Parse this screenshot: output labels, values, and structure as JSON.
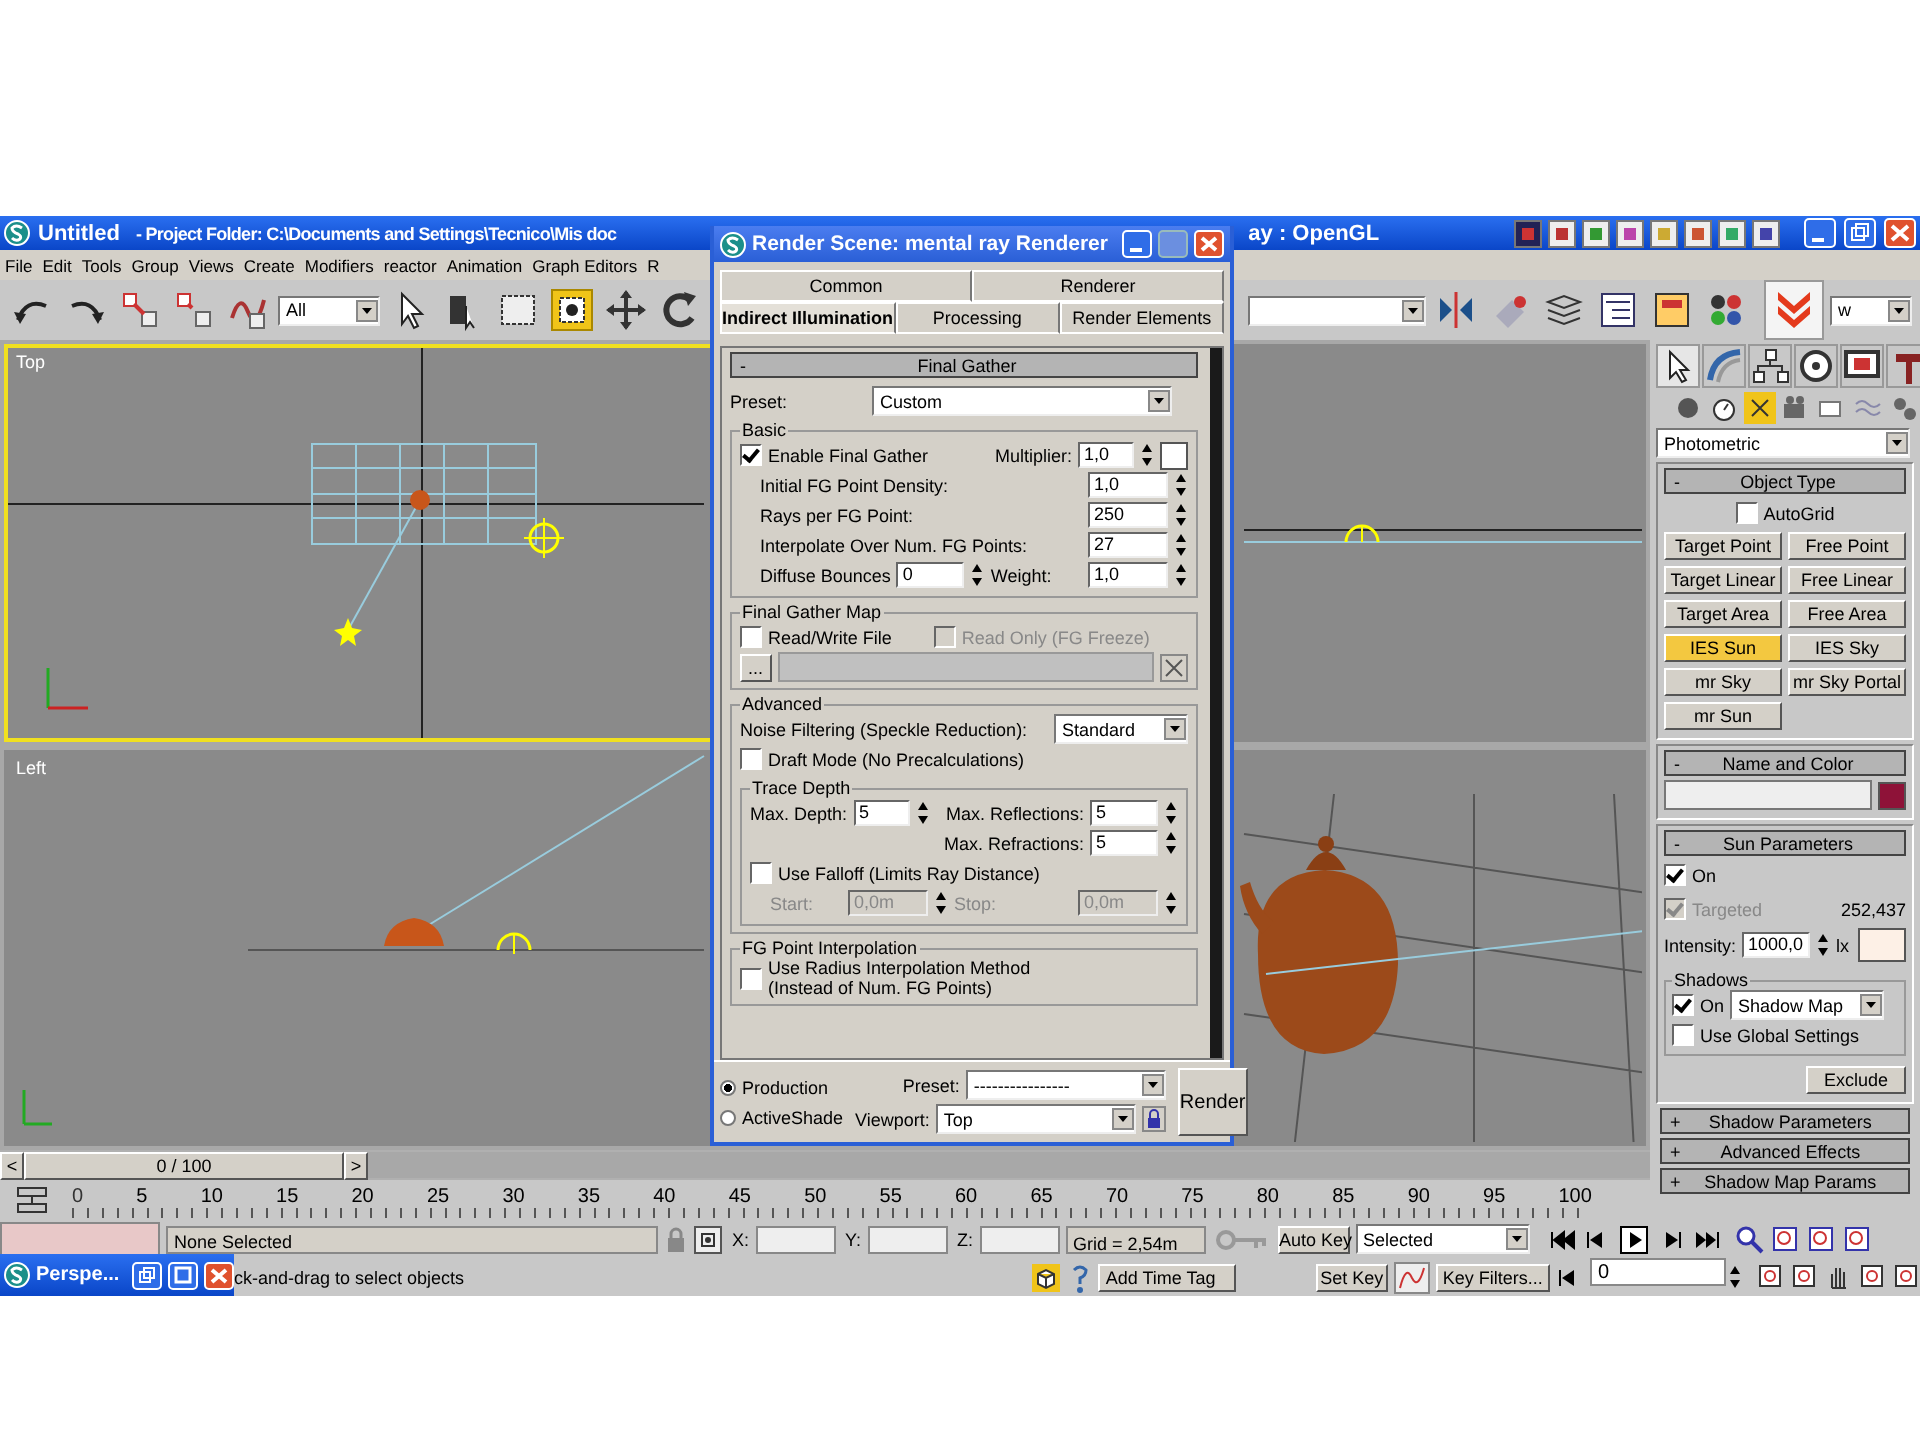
{
  "app": {
    "title": "Untitled",
    "title_path": "- Project Folder: C:\\Documents and Settings\\Tecnico\\Mis doc",
    "title_tail": "ay : OpenGL"
  },
  "menu": [
    "File",
    "Edit",
    "Tools",
    "Group",
    "Views",
    "Create",
    "Modifiers",
    "reactor",
    "Animation",
    "Graph Editors",
    "R"
  ],
  "toolbar": {
    "selection_filter": "All",
    "render_mode": "w"
  },
  "viewports": [
    {
      "kind": "top",
      "label": "Top",
      "selected": true
    },
    {
      "kind": "front",
      "selected": false
    },
    {
      "kind": "left",
      "label": "Left",
      "selected": false
    },
    {
      "kind": "perspective",
      "selected": false
    }
  ],
  "render_dialog": {
    "title": "Render Scene: mental ray Renderer",
    "tab_rows": [
      {
        "tabs": [
          {
            "label": "Common",
            "selected": false
          },
          {
            "label": "Renderer",
            "selected": false
          }
        ]
      },
      {
        "tabs": [
          {
            "label": "Indirect Illumination",
            "selected": true
          },
          {
            "label": "Processing",
            "selected": false
          },
          {
            "label": "Render Elements",
            "selected": false
          }
        ]
      }
    ],
    "rollout": {
      "sign": "-",
      "title": "Final Gather"
    },
    "preset": {
      "label": "Preset:",
      "value": "Custom"
    },
    "basic": {
      "title": "Basic",
      "enable": {
        "label": "Enable Final Gather",
        "checked": true
      },
      "multiplier": {
        "label": "Multiplier:",
        "value": "1,0",
        "color": "#ffffff"
      },
      "spinners": [
        {
          "label": "Initial FG Point Density:",
          "value": "1,0"
        },
        {
          "label": "Rays per FG Point:",
          "value": "250"
        },
        {
          "label": "Interpolate Over Num. FG Points:",
          "value": "27"
        }
      ],
      "diffuse_bounces": {
        "label": "Diffuse Bounces",
        "value": "0"
      },
      "weight": {
        "label": "Weight:",
        "value": "1,0"
      }
    },
    "fg_map": {
      "title": "Final Gather Map",
      "read_write": {
        "label": "Read/Write File",
        "checked": false
      },
      "read_only": {
        "label": "Read Only (FG Freeze)",
        "checked": false,
        "disabled": true
      },
      "browse": "..."
    },
    "advanced": {
      "title": "Advanced",
      "noise": {
        "label": "Noise Filtering (Speckle Reduction):",
        "value": "Standard"
      },
      "draft": {
        "label": "Draft Mode (No Precalculations)",
        "checked": false
      },
      "trace": {
        "title": "Trace Depth",
        "max_depth": {
          "label": "Max. Depth:",
          "value": "5"
        },
        "max_reflections": {
          "label": "Max. Reflections:",
          "value": "5"
        },
        "max_refractions": {
          "label": "Max. Refractions:",
          "value": "5"
        },
        "falloff": {
          "label": "Use Falloff (Limits Ray Distance)",
          "checked": false
        },
        "start": {
          "label": "Start:",
          "value": "0,0m",
          "disabled": true
        },
        "stop": {
          "label": "Stop:",
          "value": "0,0m",
          "disabled": true
        }
      }
    },
    "interpolation": {
      "title": "FG Point Interpolation",
      "radius": {
        "label": "Use Radius Interpolation Method\n(Instead of Num. FG Points)",
        "checked": false
      }
    },
    "modes": [
      {
        "label": "Production",
        "selected": true
      },
      {
        "label": "ActiveShade",
        "selected": false
      }
    ],
    "bottom_preset": {
      "label": "Preset:",
      "value": "----------------"
    },
    "viewport": {
      "label": "Viewport:",
      "value": "Top"
    },
    "render_button": "Render"
  },
  "command_panel": {
    "category": "Photometric",
    "object_type": {
      "sign": "-",
      "title": "Object Type",
      "autogrid": {
        "label": "AutoGrid",
        "checked": false
      },
      "buttons": [
        {
          "label": "Target Point",
          "selected": false
        },
        {
          "label": "Free Point",
          "selected": false
        },
        {
          "label": "Target Linear",
          "selected": false
        },
        {
          "label": "Free Linear",
          "selected": false
        },
        {
          "label": "Target Area",
          "selected": false
        },
        {
          "label": "Free Area",
          "selected": false
        },
        {
          "label": "IES Sun",
          "selected": true
        },
        {
          "label": "IES Sky",
          "selected": false
        },
        {
          "label": "mr Sky",
          "selected": false
        },
        {
          "label": "mr Sky Portal",
          "selected": false
        },
        {
          "label": "mr Sun",
          "selected": false
        }
      ]
    },
    "name_color": {
      "sign": "-",
      "title": "Name and Color",
      "color": "#8e1238"
    },
    "sun": {
      "sign": "-",
      "title": "Sun Parameters",
      "on": {
        "label": "On",
        "checked": true
      },
      "targeted": {
        "label": "Targeted",
        "checked": true,
        "disabled": true
      },
      "distance": "252,437",
      "intensity": {
        "label": "Intensity:",
        "value": "1000,0",
        "unit": "lx",
        "color": "#fdf0e6"
      },
      "shadows": {
        "title": "Shadows",
        "on": {
          "label": "On",
          "checked": true
        },
        "type": "Shadow Map",
        "global": {
          "label": "Use Global Settings",
          "checked": false
        }
      },
      "exclude": "Exclude"
    },
    "collapsed": [
      {
        "sign": "+",
        "title": "Shadow Parameters"
      },
      {
        "sign": "+",
        "title": "Advanced Effects"
      },
      {
        "sign": "+",
        "title": "Shadow Map Params"
      }
    ]
  },
  "time_slider": {
    "prev": "<",
    "label": "0 / 100",
    "next": ">"
  },
  "track": {
    "frames": [
      "0",
      "5",
      "10",
      "15",
      "20",
      "25",
      "30",
      "35",
      "40",
      "45",
      "50",
      "55",
      "60",
      "65",
      "70",
      "75",
      "80",
      "85",
      "90",
      "95",
      "100"
    ]
  },
  "status": {
    "selection": "None Selected",
    "coords": [
      {
        "label": "X:"
      },
      {
        "label": "Y:"
      },
      {
        "label": "Z:"
      }
    ],
    "grid": "Grid = 2,54m",
    "auto_key": "Auto Key",
    "key_mode": "Selected",
    "prompt": "ck-and-drag to select objects",
    "add_time_tag": "Add Time Tag",
    "set_key": "Set Key",
    "key_filters": "Key Filters...",
    "frame": "0"
  },
  "minimized_window": {
    "title": "Perspe..."
  }
}
